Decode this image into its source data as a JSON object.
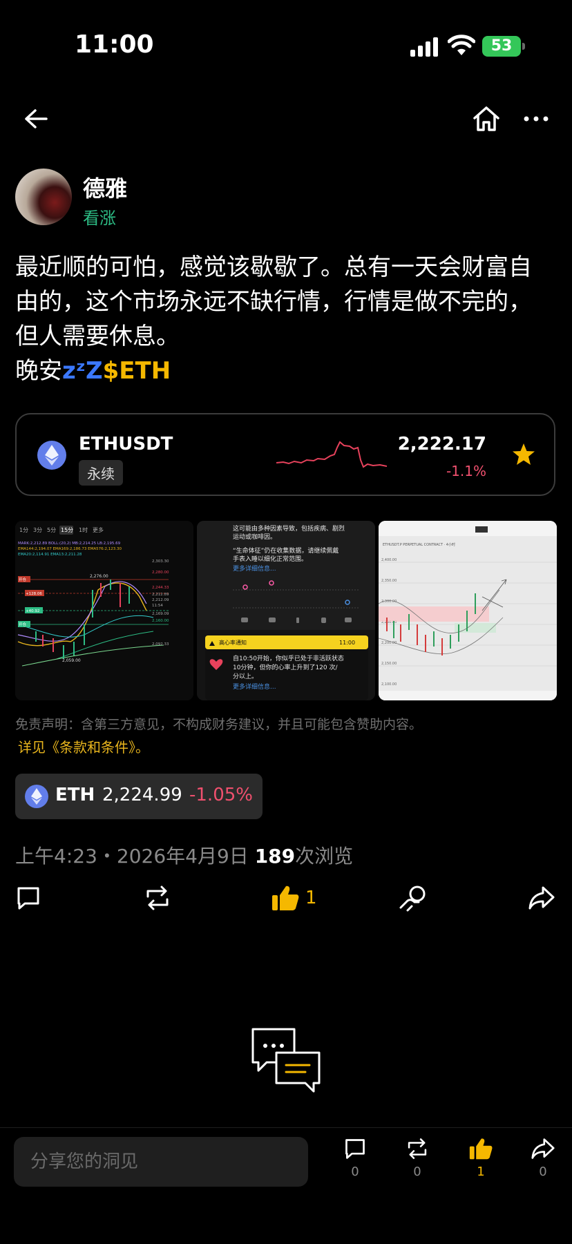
{
  "status_bar": {
    "time": "11:00",
    "battery": "53"
  },
  "author": {
    "name": "德雅",
    "tag": "看涨"
  },
  "post": {
    "lines": [
      "最近顺的可怕，感觉该歇歇了。总有一天会财富自",
      "由的，这个市场永远不缺行情，行情是做不完的，",
      "但人需要休息。"
    ],
    "last_prefix": "晚安",
    "zzz": "zᶻZ",
    "cashtag": "$ETH"
  },
  "ticker_card": {
    "symbol": "ETHUSDT",
    "type": "永续",
    "price": "2,222.17",
    "change": "-1.1%",
    "change_color": "#f0506e",
    "starred": true
  },
  "images": {
    "img1": {
      "tabs": [
        "1分",
        "3分",
        "5分",
        "15分",
        "1时",
        "更多"
      ],
      "active_tab": "15分",
      "indicator_row1": "MARK:2,212.89  BOLL:(20,2)  MB:2,214.25  LB:2,195.69",
      "indicator_row2": "EMA144:2,194.07  EMA169:2,186.73  EMA576:2,123.30",
      "indicator_row3": "EMA20:2,114.91  EMA13:2,211.28",
      "price_labels": [
        "2,303.30",
        "2,280.00",
        "2,244.33",
        "2,212.89",
        "2,212.09",
        "11:54",
        "2,169.09",
        "2,160.00",
        "2,092.33"
      ],
      "high_label": "2,276.00",
      "low_label": "2,059.00",
      "left_tags": [
        "开仓",
        "+128.06",
        "+40.92",
        "开仓"
      ]
    },
    "img2": {
      "text_top": [
        "这可能由多种因素导致，包括疾病、剧烈",
        "运动或咖啡因。"
      ],
      "text_mid": [
        "“生命体征”仍在收集数据，请继续佩戴",
        "手表入睡以细化正常范围。"
      ],
      "link1": "更多详细信息...",
      "alert_title": "高心率通知",
      "alert_time": "11:00",
      "alert_text": [
        "自10:50开始，你似乎已处于非活跃状态",
        "10分钟，但你的心率上升到了120 次/",
        "分以上。"
      ],
      "link2": "更多详细信息..."
    },
    "img3": {
      "header": "ETHUSDT.P  PERPETUAL CONTRACT · 4小时",
      "prices": [
        "2,400.00",
        "2,350.00",
        "2,300.00",
        "2,250.00",
        "2,200.00",
        "2,150.00",
        "2,100.00"
      ]
    }
  },
  "disclaimer": {
    "text": "免责声明：含第三方意见，不构成财务建议，并且可能包含赞助内容。",
    "terms": "详见《条款和条件》。"
  },
  "price_chip": {
    "symbol": "ETH",
    "price": "2,224.99",
    "change": "-1.05%"
  },
  "meta": {
    "time": "上午4:23",
    "sep": "・",
    "date": "2026年4月9日",
    "views": "189",
    "views_label": "次浏览"
  },
  "actions": {
    "like_count": "1"
  },
  "bottom_bar": {
    "placeholder": "分享您的洞见",
    "comments": "0",
    "reposts": "0",
    "likes": "1",
    "shares": "0"
  },
  "colors": {
    "accent_yellow": "#f5b800",
    "bull_green": "#2dbd85",
    "bear_red": "#f0506e",
    "eth_blue": "#627eea"
  }
}
